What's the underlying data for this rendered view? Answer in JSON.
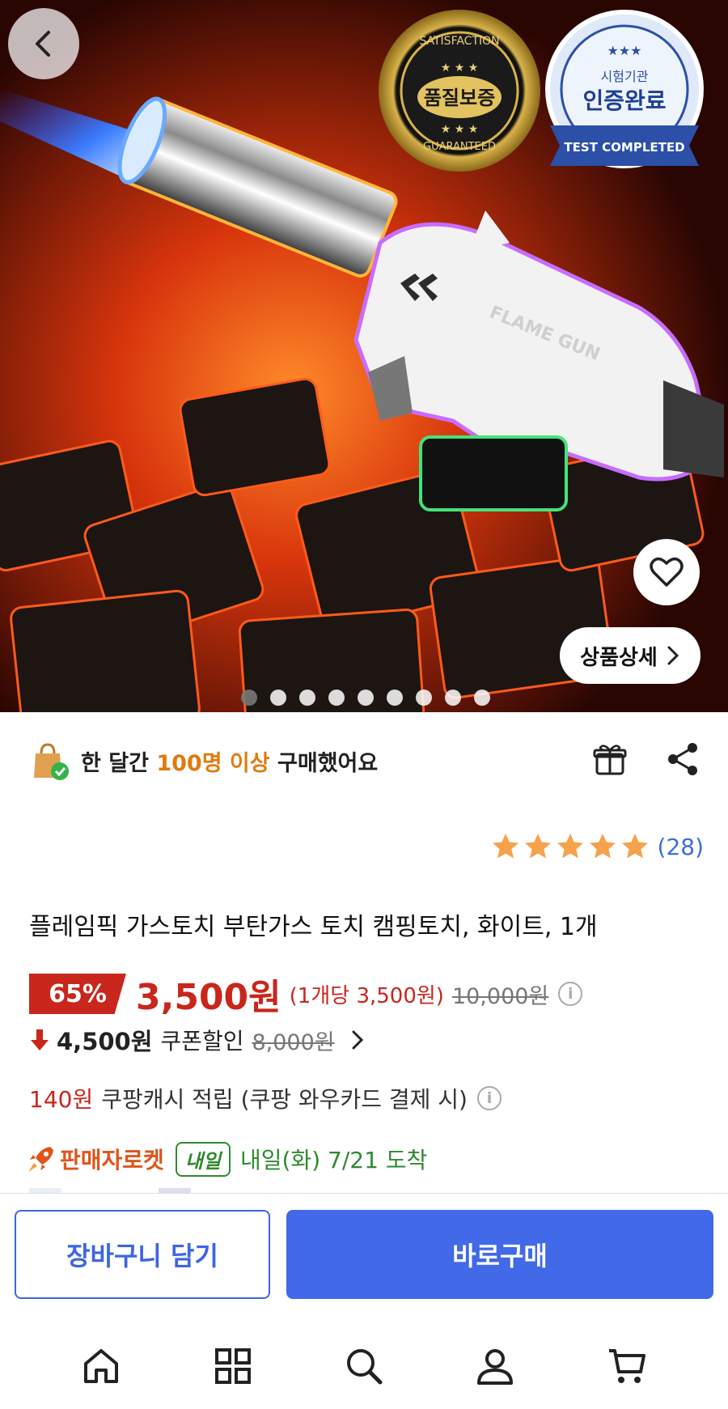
{
  "hero": {
    "badge_left": {
      "top": "SATISFACTION",
      "center": "품질보증",
      "bottom": "GUARANTEED"
    },
    "badge_right": {
      "small": "시험기관",
      "main": "인증완료",
      "ribbon": "TEST COMPLETED"
    },
    "product_embossed_text": "FLAME GUN",
    "detail_button_label": "상품상세",
    "carousel": {
      "total": 9,
      "active_index": 0
    }
  },
  "purchase": {
    "prefix": "한 달간 ",
    "highlight": "100명 이상",
    "suffix": " 구매했어요"
  },
  "rating": {
    "stars": 5,
    "count": "(28)"
  },
  "product": {
    "title": "플레임픽 가스토치 부탄가스 토치 캠핑토치, 화이트, 1개"
  },
  "price": {
    "discount": "65%",
    "sale_price": "3,500원",
    "unit_price": "(1개당 3,500원)",
    "original_price": "10,000원"
  },
  "coupon": {
    "price": "4,500원",
    "label": "쿠폰할인",
    "original": "8,000원"
  },
  "cashback": {
    "amount": "140원",
    "text": "쿠팡캐시 적립 (쿠팡 와우카드 결제 시)"
  },
  "delivery": {
    "label": "판매자로켓",
    "badge": "내일",
    "text": "내일(화) 7/21 도착"
  },
  "actions": {
    "cart_label": "장바구니 담기",
    "buy_label": "바로구매"
  },
  "tabs": [
    "home-icon",
    "category-icon",
    "search-icon",
    "profile-icon",
    "cart-icon"
  ],
  "colors": {
    "accent_blue": "#4169e8",
    "price_red": "#c9261c",
    "highlight_orange": "#e07a10",
    "rocket_green": "#2f8a2f",
    "star": "#f5a24b"
  }
}
